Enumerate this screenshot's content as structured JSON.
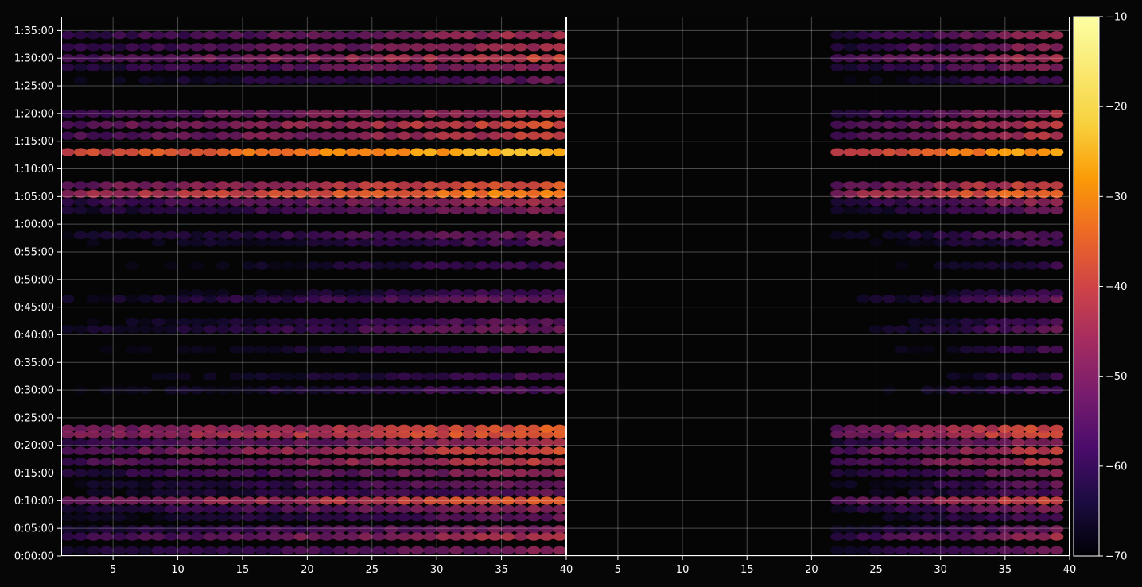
{
  "chart_data": {
    "type": "heatmap",
    "title": "",
    "xlabel": "",
    "ylabel": "",
    "panels": [
      {
        "name": "",
        "xlim": [
          1,
          40
        ],
        "x_ticks": [
          5,
          10,
          15,
          20,
          25,
          30,
          35,
          40
        ],
        "columns_with_data": [
          1,
          39
        ],
        "grid": true
      },
      {
        "name": "",
        "xlim": [
          1,
          40
        ],
        "x_ticks": [
          5,
          10,
          15,
          20,
          25,
          30,
          35,
          40
        ],
        "columns_with_data": [
          22,
          39
        ],
        "grid": true
      }
    ],
    "y_axis": {
      "ylim_seconds": [
        0,
        5850
      ],
      "tick_seconds": [
        0,
        300,
        600,
        900,
        1200,
        1500,
        1800,
        2100,
        2400,
        2700,
        3000,
        3300,
        3600,
        3900,
        4200,
        4500,
        4800,
        5100,
        5400,
        5700
      ],
      "tick_labels": [
        "0:00:00",
        "0:05:00",
        "0:10:00",
        "0:15:00",
        "0:20:00",
        "0:25:00",
        "0:30:00",
        "0:35:00",
        "0:40:00",
        "0:45:00",
        "0:50:00",
        "0:55:00",
        "1:00:00",
        "1:05:00",
        "1:10:00",
        "1:15:00",
        "1:20:00",
        "1:25:00",
        "1:30:00",
        "1:35:00"
      ]
    },
    "colorbar": {
      "min": -70,
      "max": -10,
      "ticks": [
        -70,
        -60,
        -50,
        -40,
        -30,
        -20,
        -10
      ],
      "tick_labels": [
        "−70",
        "−60",
        "−50",
        "−40",
        "−30",
        "−20",
        "−10"
      ],
      "colormap": "inferno",
      "placement": "right"
    },
    "bands": [
      {
        "t": 60,
        "level": -48
      },
      {
        "t": 210,
        "level": -42
      },
      {
        "t": 290,
        "level": -48
      },
      {
        "t": 420,
        "level": -52
      },
      {
        "t": 510,
        "level": -46
      },
      {
        "t": 600,
        "level": -36
      },
      {
        "t": 690,
        "level": -52
      },
      {
        "t": 780,
        "level": -50
      },
      {
        "t": 900,
        "level": -46
      },
      {
        "t": 1020,
        "level": -40
      },
      {
        "t": 1140,
        "level": -38
      },
      {
        "t": 1230,
        "level": -44
      },
      {
        "t": 1320,
        "level": -34
      },
      {
        "t": 1380,
        "level": -36
      },
      {
        "t": 1800,
        "level": -54
      },
      {
        "t": 1950,
        "level": -56
      },
      {
        "t": 2240,
        "level": -55
      },
      {
        "t": 2460,
        "level": -50
      },
      {
        "t": 2540,
        "level": -52
      },
      {
        "t": 2790,
        "level": -50
      },
      {
        "t": 2850,
        "level": -56
      },
      {
        "t": 3150,
        "level": -56
      },
      {
        "t": 3400,
        "level": -54
      },
      {
        "t": 3480,
        "level": -50
      },
      {
        "t": 3750,
        "level": -48
      },
      {
        "t": 3840,
        "level": -44
      },
      {
        "t": 3930,
        "level": -30
      },
      {
        "t": 4020,
        "level": -36
      },
      {
        "t": 4380,
        "level": -24
      },
      {
        "t": 4560,
        "level": -40
      },
      {
        "t": 4680,
        "level": -38
      },
      {
        "t": 4800,
        "level": -42
      },
      {
        "t": 5160,
        "level": -52
      },
      {
        "t": 5300,
        "level": -46
      },
      {
        "t": 5400,
        "level": -40
      },
      {
        "t": 5520,
        "level": -44
      },
      {
        "t": 5650,
        "level": -44
      }
    ]
  }
}
